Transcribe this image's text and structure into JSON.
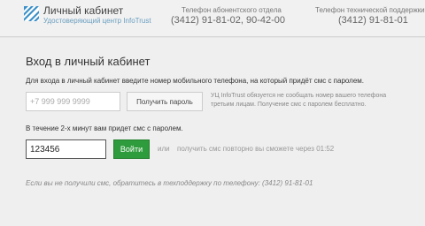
{
  "header": {
    "title": "Личный кабинет",
    "subtitle": "Удостоверяющий центр InfoTrust",
    "logo_icon": "diagonal-stripes-logo",
    "subscriber": {
      "label": "Телефон абонентского отдела",
      "phone": "(3412) 91-81-02, 90-42-00"
    },
    "support": {
      "label": "Телефон технической поддержки",
      "phone": "(3412) 91-81-01"
    }
  },
  "login": {
    "title": "Вход в личный кабинет",
    "instruction": "Для входа в личный кабинет введите номер мобильного телефона, на который придёт смс с паролем.",
    "phone_placeholder": "+7 999 999 9999",
    "phone_value": "",
    "get_password_label": "Получить пароль",
    "privacy_note": "УЦ InfoTrust обязуется не сообщать номер вашего телефона третьим лицам. Получение смс с паролем бесплатно.",
    "sms_info": "В течение 2-х минут вам придет смс с паролем.",
    "code_value": "123456",
    "login_button_label": "Войти",
    "or_label": "или",
    "resend_text": "получить смс повторно вы сможете через 01:52",
    "support_note": "Если вы не получили смс, обратитесь в техподдержку по телефону: (3412) 91-81-01"
  },
  "colors": {
    "accent_link": "#6a9fbf",
    "logo_blue": "#3a8fc8",
    "login_button": "#2e9b3c"
  }
}
